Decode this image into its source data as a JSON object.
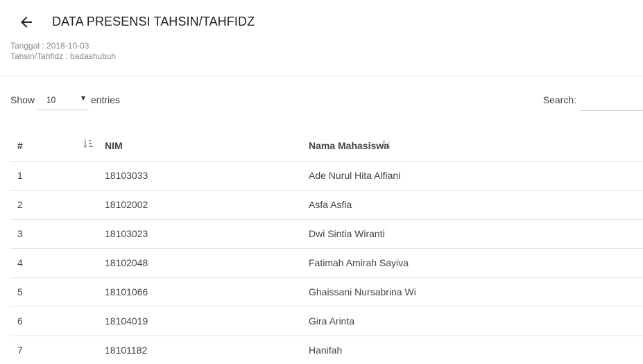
{
  "header": {
    "title": "DATA PRESENSI TAHSIN/TAHFIDZ",
    "back_icon": "arrow-left-icon",
    "date_line": "Tanggal : 2018-10-03",
    "group_line": "Tahsin/Tahfidz : badashubuh"
  },
  "controls": {
    "show_label": "Show",
    "length_value": "10",
    "entries_label": "entries",
    "search_label": "Search:",
    "search_value": ""
  },
  "table": {
    "columns": [
      "#",
      "NIM",
      "Nama Mahasiswa"
    ],
    "sort_icons": [
      "sort-ascending-icon",
      "sort-both-icon"
    ],
    "rows": [
      {
        "no": "1",
        "nim": "18103033",
        "nama": "Ade Nurul Hita Alfiani"
      },
      {
        "no": "2",
        "nim": "18102002",
        "nama": "Asfa Asfia"
      },
      {
        "no": "3",
        "nim": "18103023",
        "nama": "Dwi Sintia Wiranti"
      },
      {
        "no": "4",
        "nim": "18102048",
        "nama": "Fatimah Amirah Sayiva"
      },
      {
        "no": "5",
        "nim": "18101066",
        "nama": "Ghaissani Nursabrina Wi"
      },
      {
        "no": "6",
        "nim": "18104019",
        "nama": "Gira Arinta"
      },
      {
        "no": "7",
        "nim": "18101182",
        "nama": "Hanifah"
      }
    ]
  }
}
